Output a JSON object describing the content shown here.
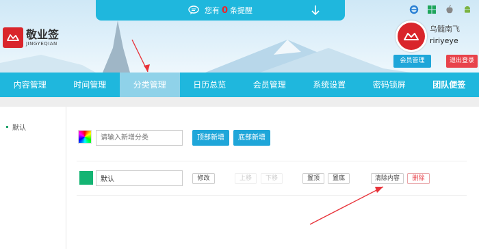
{
  "notice": {
    "prefix": "您有",
    "count": "0",
    "suffix": "条提醒"
  },
  "logo": {
    "cn": "敬业签",
    "en": "JINGYEQIAN"
  },
  "user": {
    "name": "乌髓南飞",
    "id": "ririyeye",
    "member_button": "会员管理",
    "logout_button": "退出登录"
  },
  "platforms": [
    "ie-icon",
    "windows-icon",
    "apple-icon",
    "android-icon"
  ],
  "nav": {
    "items": [
      {
        "label": "内容管理"
      },
      {
        "label": "时间管理"
      },
      {
        "label": "分类管理"
      },
      {
        "label": "日历总览"
      },
      {
        "label": "会员管理"
      },
      {
        "label": "系统设置"
      },
      {
        "label": "密码锁屏"
      },
      {
        "label": "团队便签"
      }
    ],
    "active_index": 2
  },
  "sidebar": {
    "items": [
      {
        "label": "默认"
      }
    ]
  },
  "new_category": {
    "placeholder": "请输入新增分类",
    "top_add": "顶部新增",
    "bottom_add": "底部新增"
  },
  "category_row": {
    "name": "默认",
    "color": "#14b473",
    "edit": "修改",
    "move_up": "上移",
    "move_down": "下移",
    "pin_top": "置顶",
    "pin_bottom": "置底",
    "clear": "清除内容",
    "delete": "删除"
  },
  "colors": {
    "accent": "#1fb7dd",
    "button_blue": "#1fa6d9",
    "danger": "#e8434b",
    "brand_red": "#d9252b",
    "arrow": "#e8343b"
  }
}
